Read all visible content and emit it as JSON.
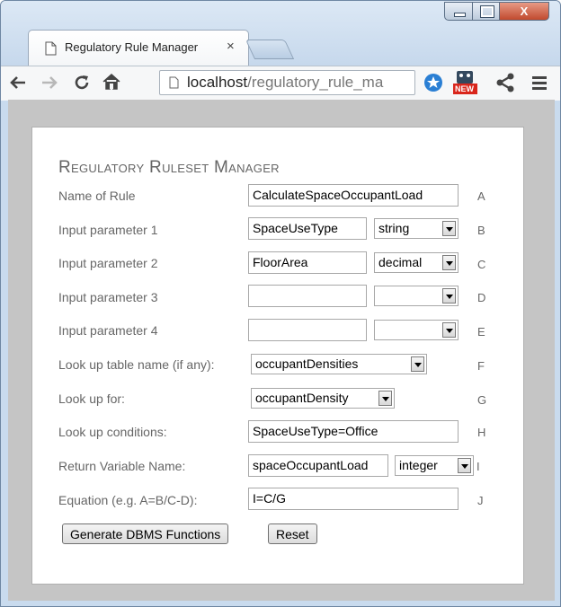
{
  "browser": {
    "tab_title": "Regulatory Rule Manager",
    "tab_close": "×",
    "url_host": "localhost",
    "url_path": "/regulatory_rule_ma",
    "new_badge": "NEW"
  },
  "form": {
    "heading": "Regulatory Ruleset Manager",
    "rows": [
      {
        "label": "Name of Rule",
        "value": "CalculateSpaceOccupantLoad",
        "letter": "A"
      },
      {
        "label": "Input parameter 1",
        "value": "SpaceUseType",
        "type": "string",
        "letter": "B"
      },
      {
        "label": "Input parameter 2",
        "value": "FloorArea",
        "type": "decimal",
        "letter": "C"
      },
      {
        "label": "Input parameter 3",
        "value": "",
        "type": "",
        "letter": "D"
      },
      {
        "label": "Input parameter 4",
        "value": "",
        "type": "",
        "letter": "E"
      },
      {
        "label": "Look up table name (if any):",
        "value": "occupantDensities",
        "letter": "F"
      },
      {
        "label": "Look up for:",
        "value": "occupantDensity",
        "letter": "G"
      },
      {
        "label": "Look up conditions:",
        "value": "SpaceUseType=Office",
        "letter": "H"
      },
      {
        "label": "Return Variable Name:",
        "value": "spaceOccupantLoad",
        "type": "integer",
        "letter": "I"
      },
      {
        "label": "Equation (e.g. A=B/C-D):",
        "value": "I=C/G",
        "letter": "J"
      }
    ],
    "generate_button": "Generate DBMS Functions",
    "reset_button": "Reset"
  },
  "colors": {
    "frame": "#c9dbee",
    "close_button": "#c14a2e",
    "label_text": "#666666",
    "page_background": "#c5c5c5"
  },
  "icons": [
    "document-icon",
    "back-icon",
    "forward-icon",
    "reload-icon",
    "home-icon",
    "extension-blue-icon",
    "new-extension-icon",
    "share-icon",
    "menu-icon"
  ]
}
